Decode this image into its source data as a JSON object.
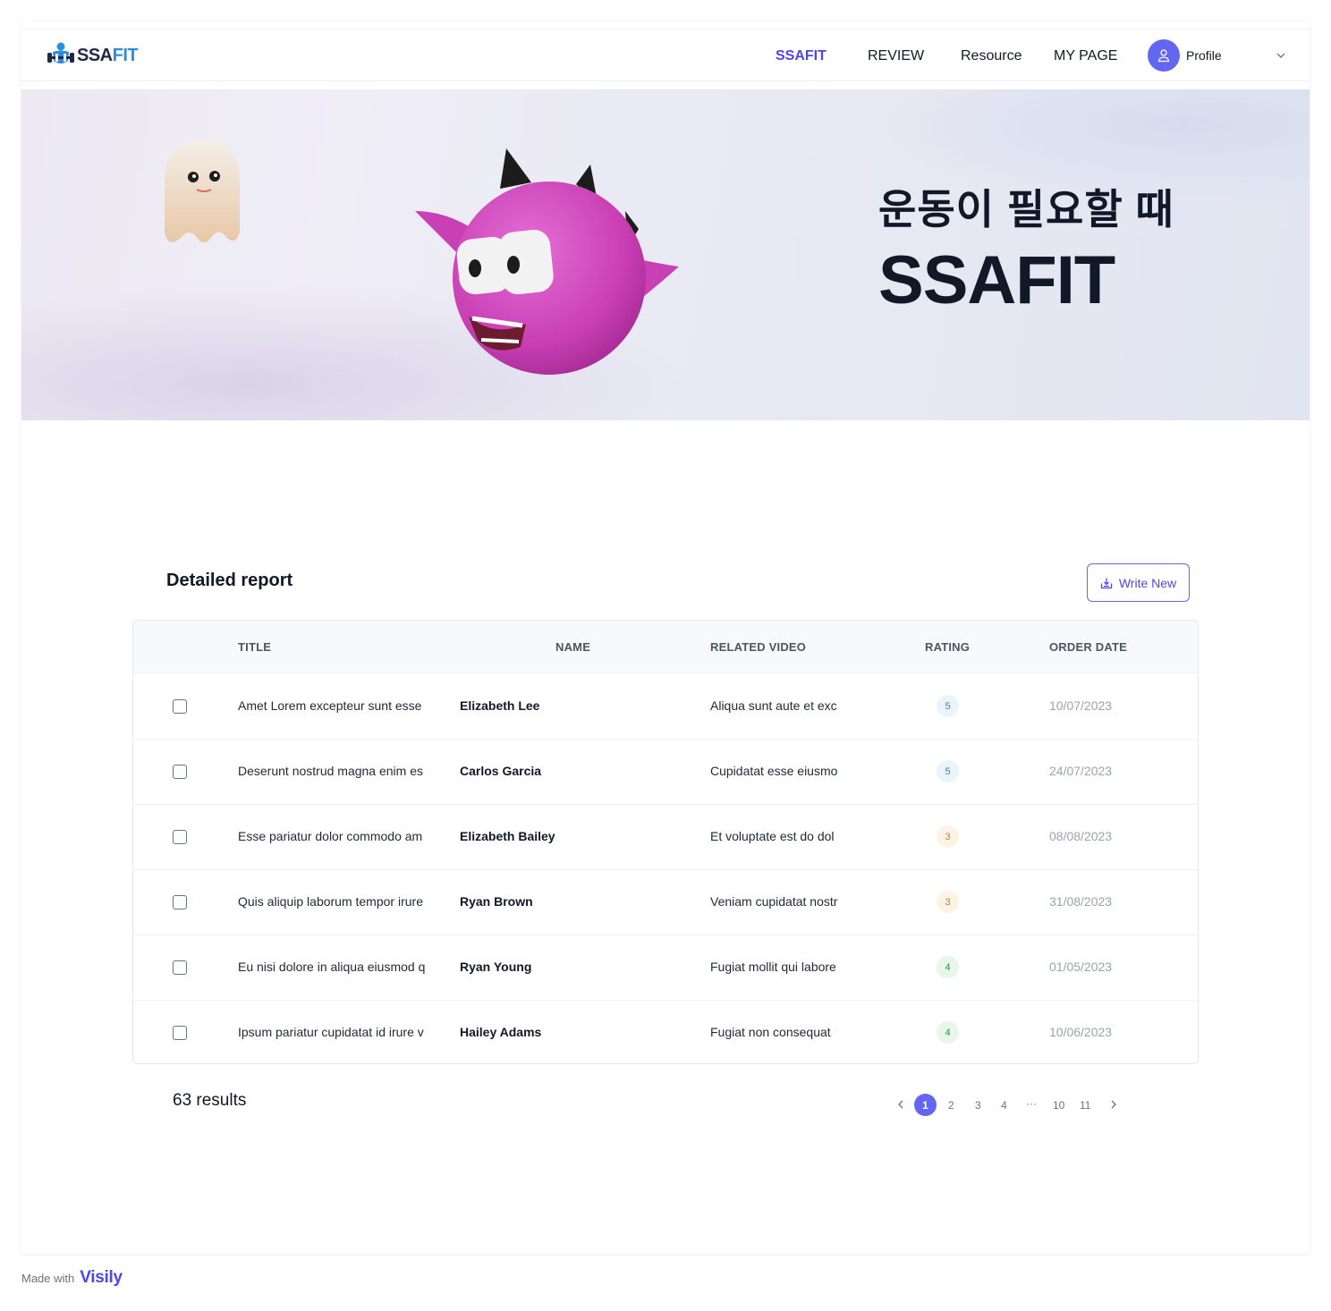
{
  "brand": {
    "logo_prefix": "SSA",
    "logo_suffix": "FIT",
    "accent": "#4f46e5",
    "logo_blue": "#2b8fe0"
  },
  "nav": {
    "items": [
      {
        "label": "SSAFIT",
        "active": true
      },
      {
        "label": "REVIEW",
        "active": false
      },
      {
        "label": "Resource",
        "active": false
      },
      {
        "label": "MY PAGE",
        "active": false
      }
    ],
    "profile_label": "Profile",
    "profile_icon": "user-icon",
    "dropdown_icon": "chevron-down-icon"
  },
  "hero": {
    "subtitle": "운동이 필요할 때",
    "title": "SSAFIT"
  },
  "report": {
    "title": "Detailed report",
    "write_button_label": "Write New",
    "write_button_icon": "download-tray-icon",
    "columns": [
      "TITLE",
      "NAME",
      "RELATED VIDEO",
      "RATING",
      "ORDER DATE"
    ],
    "rows": [
      {
        "title": "Amet Lorem excepteur sunt esse",
        "name": "Elizabeth Lee",
        "video": "Aliqua sunt aute et exc",
        "rating": "5",
        "date": "10/07/2023",
        "checked": false
      },
      {
        "title": "Deserunt nostrud magna enim es",
        "name": "Carlos Garcia",
        "video": "Cupidatat esse eiusmo",
        "rating": "5",
        "date": "24/07/2023",
        "checked": false
      },
      {
        "title": "Esse pariatur dolor commodo am",
        "name": "Elizabeth Bailey",
        "video": "Et voluptate est do dol",
        "rating": "3",
        "date": "08/08/2023",
        "checked": false
      },
      {
        "title": "Quis aliquip laborum tempor irure",
        "name": "Ryan Brown",
        "video": "Veniam cupidatat nostr",
        "rating": "3",
        "date": "31/08/2023",
        "checked": false
      },
      {
        "title": "Eu nisi dolore in aliqua eiusmod q",
        "name": "Ryan Young",
        "video": "Fugiat mollit qui labore",
        "rating": "4",
        "date": "01/05/2023",
        "checked": false
      },
      {
        "title": "Ipsum pariatur cupidatat id irure v",
        "name": "Hailey Adams",
        "video": "Fugiat non consequat",
        "rating": "4",
        "date": "10/06/2023",
        "checked": false
      }
    ],
    "rating_colors": {
      "5": {
        "bg": "#eaf4fb",
        "fg": "#3b82b6"
      },
      "3": {
        "bg": "#fdf3e4",
        "fg": "#c2812b"
      },
      "4": {
        "bg": "#e8f7ec",
        "fg": "#2f8f4e"
      }
    }
  },
  "footer": {
    "results": "63 results",
    "pages": [
      "1",
      "2",
      "3",
      "4",
      "···",
      "10",
      "11"
    ],
    "current_page": "1",
    "prev_icon": "chevron-left-icon",
    "next_icon": "chevron-right-icon"
  },
  "watermark": {
    "made_with": "Made with",
    "brand": "Visily"
  }
}
